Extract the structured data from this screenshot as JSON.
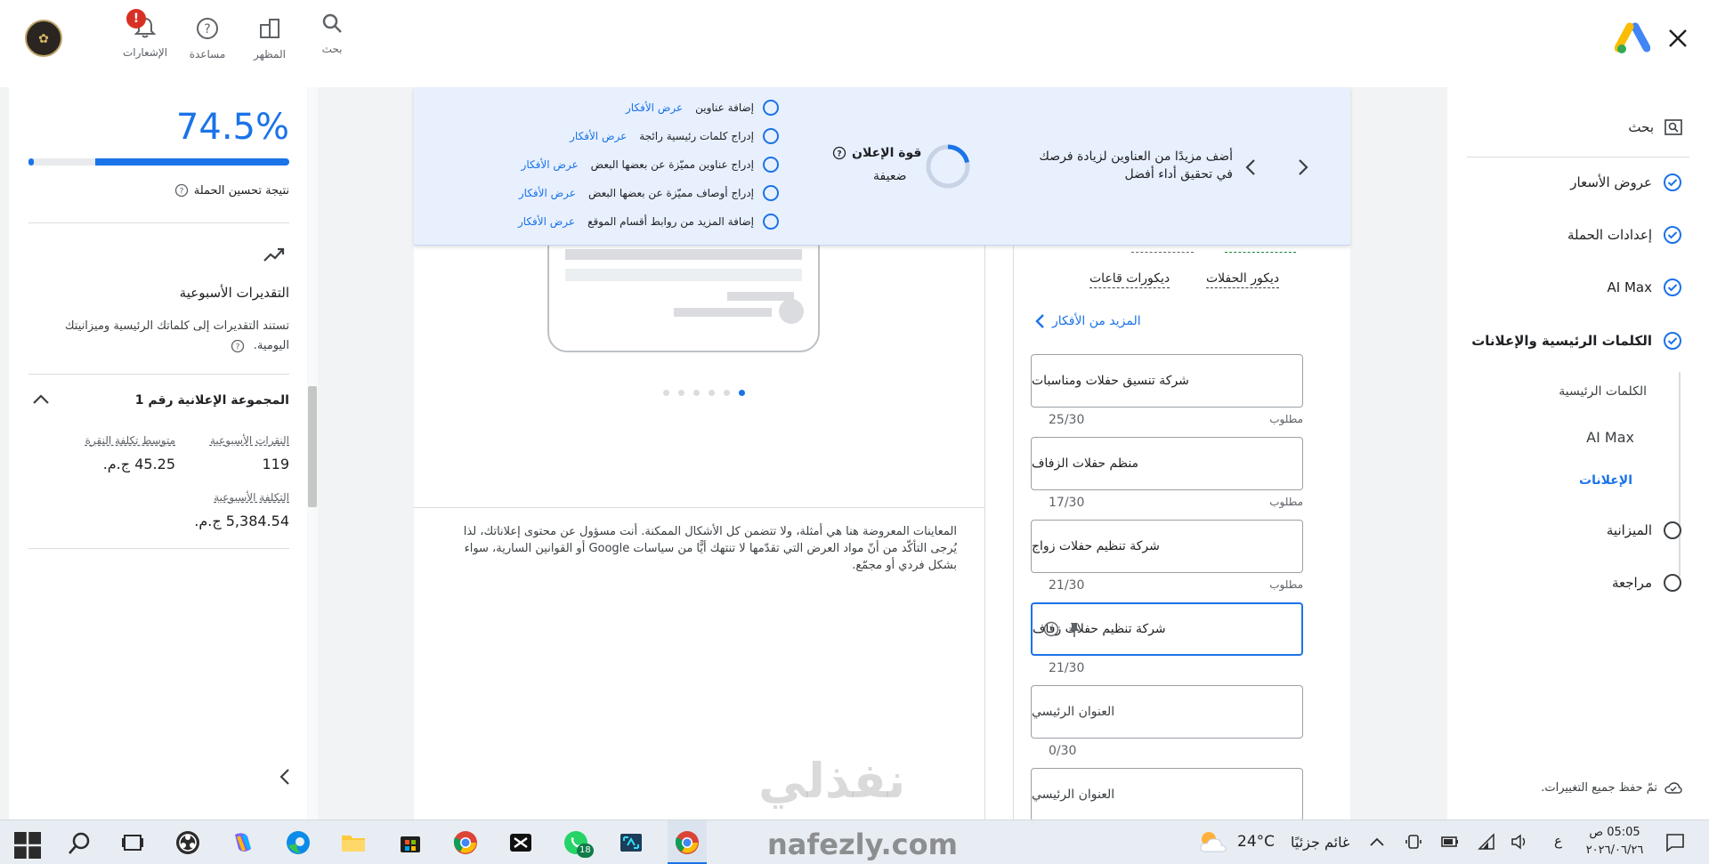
{
  "topbar": {
    "close_icon": "close-icon",
    "logo_icon": "google-ads-logo",
    "search_label": "بحث",
    "appearance_label": "المظهر",
    "help_label": "مساعدة",
    "notifications_label": "الإشعارات",
    "notification_badge": "!"
  },
  "nav": {
    "search": "بحث",
    "items": [
      {
        "label": "عروض الأسعار",
        "state": "done"
      },
      {
        "label": "إعدادات الحملة",
        "state": "done"
      },
      {
        "label": "AI Max",
        "state": "done"
      },
      {
        "label": "الكلمات الرئيسية والإعلانات",
        "state": "done"
      },
      {
        "label": "الميزانية",
        "state": "empty"
      },
      {
        "label": "مراجعة",
        "state": "empty"
      }
    ],
    "sub_keywords": "الكلمات الرئيسية",
    "sub_aimax": "AI Max",
    "sub_ads": "الإعلانات",
    "saved_text": "تمّ حفظ جميع التغييرات."
  },
  "banner": {
    "message": "أضف مزيدًا من العناوين لزيادة فرصك في تحقيق أداء أفضل",
    "strength_label": "قوة الإعلان",
    "strength_value": "ضعيفة",
    "suggestions": [
      {
        "text": "إضافة عناوين",
        "link": "عرض الأفكار"
      },
      {
        "text": "إدراج كلمات رئيسية رائجة",
        "link": "عرض الأفكار"
      },
      {
        "text": "إدراج عناوين مميّزة عن بعضها البعض",
        "link": "عرض الأفكار"
      },
      {
        "text": "إدراج أوصاف مميّزة عن بعضها البعض",
        "link": "عرض الأفكار"
      },
      {
        "text": "إضافة المزيد من روابط أقسام الموقع",
        "link": "عرض الأفكار"
      }
    ]
  },
  "ideas": {
    "chips": [
      "ديكور الحفلات",
      "ديكورات قاعات"
    ],
    "more_ideas": "المزيد من الأفكار"
  },
  "headlines": [
    {
      "value": "شركة تنسيق حفلات ومناسبات",
      "required": "مطلوب",
      "count": "25/30"
    },
    {
      "value": "منظم حفلات الزفاف",
      "required": "مطلوب",
      "count": "17/30"
    },
    {
      "value": "شركة تنظيم حفلات زواج",
      "required": "مطلوب",
      "count": "21/30"
    },
    {
      "value": "شركة تنظيم حفلات زفاف",
      "required": "",
      "count": "21/30"
    },
    {
      "value": "العنوان الرئيسي",
      "required": "",
      "count": "0/30"
    },
    {
      "value": "العنوان الرئيسي",
      "required": "",
      "count": ""
    }
  ],
  "preview": {
    "disclaimer": "المعاينات المعروضة هنا هي أمثلة، ولا تتضمن كل الأشكال الممكنة. أنت مسؤول عن محتوى إعلاناتك، لذا يُرجى التأكّد من أنّ مواد العرض التي تقدّمها لا تنتهك أيًّا من سياسات Google أو القوانين السارية، سواء بشكل فردي أو مجمّع."
  },
  "left": {
    "score_value": "74.5%",
    "score_progress": 0.745,
    "score_label": "نتيجة تحسين الحملة",
    "weekly_title": "التقديرات الأسبوعية",
    "weekly_desc": "تستند التقديرات إلى كلماتك الرئيسية وميزانيتك اليومية.",
    "adgroup_title": "المجموعة الإعلانية رقم 1",
    "clicks_label": "النقرات الأسبوعية",
    "clicks_value": "119",
    "cpc_label": "متوسط تكلفة النقرة",
    "cpc_value": "45.25 ج.م.",
    "cost_label": "التكلفة الأسبوعية",
    "cost_value": "5,384.54 ج.م."
  },
  "watermark": {
    "arabic": "نفذلي",
    "latin": "nafezly.com"
  },
  "taskbar": {
    "weather_temp": "24°C",
    "weather_text": "غائم جزئيًا",
    "time": "05:05 ص",
    "date": "٢٠٢٦/٠٦/٢٦",
    "lang": "ع",
    "whatsapp_badge": "18"
  },
  "colors": {
    "accent": "#1a73e8",
    "banner_bg": "#e8f0fe",
    "taskbar_bg": "#e8edf3"
  }
}
